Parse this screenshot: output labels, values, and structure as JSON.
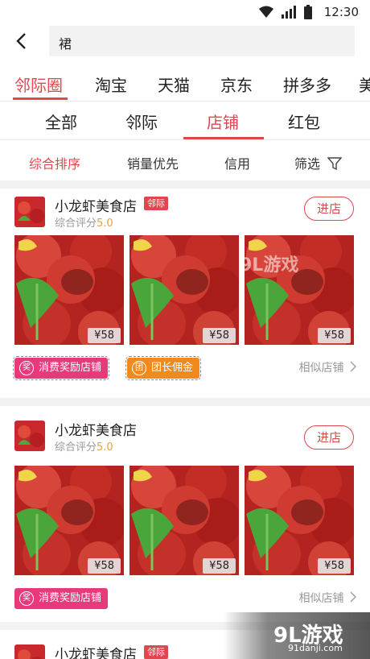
{
  "status_bar": {
    "time": "12:30"
  },
  "search": {
    "query": "裙"
  },
  "platform_tabs": [
    "邻际圈",
    "淘宝",
    "天猫",
    "京东",
    "拼多多",
    "美"
  ],
  "sub_tabs": [
    "全部",
    "邻际",
    "店铺",
    "红包"
  ],
  "sort_options": [
    "综合排序",
    "销量优先",
    "信用",
    "筛选"
  ],
  "stores": [
    {
      "name": "小龙虾美食店",
      "badge": "邻际",
      "rating_label": "综合评分",
      "rating": "5.0",
      "enter_label": "进店",
      "prices": [
        "¥58",
        "¥58",
        "¥58"
      ],
      "tags": [
        {
          "label": "消费奖励店铺",
          "icon": "奖"
        },
        {
          "label": "团长佣金",
          "icon": "团"
        }
      ],
      "similar_label": "相似店铺"
    },
    {
      "name": "小龙虾美食店",
      "badge": "",
      "rating_label": "综合评分",
      "rating": "5.0",
      "enter_label": "进店",
      "prices": [
        "¥58",
        "¥58",
        "¥58"
      ],
      "tags": [
        {
          "label": "消费奖励店铺",
          "icon": "奖"
        }
      ],
      "similar_label": "相似店铺"
    },
    {
      "name": "小龙虾美食店",
      "badge": "邻际"
    }
  ],
  "watermark": {
    "title": "9L游戏",
    "subtitle": "91danji.com",
    "photo_mark": "9L游戏"
  },
  "colors": {
    "accent": "#e1454e",
    "pink_tag": "#e8397c",
    "orange_tag": "#f08a1c"
  }
}
